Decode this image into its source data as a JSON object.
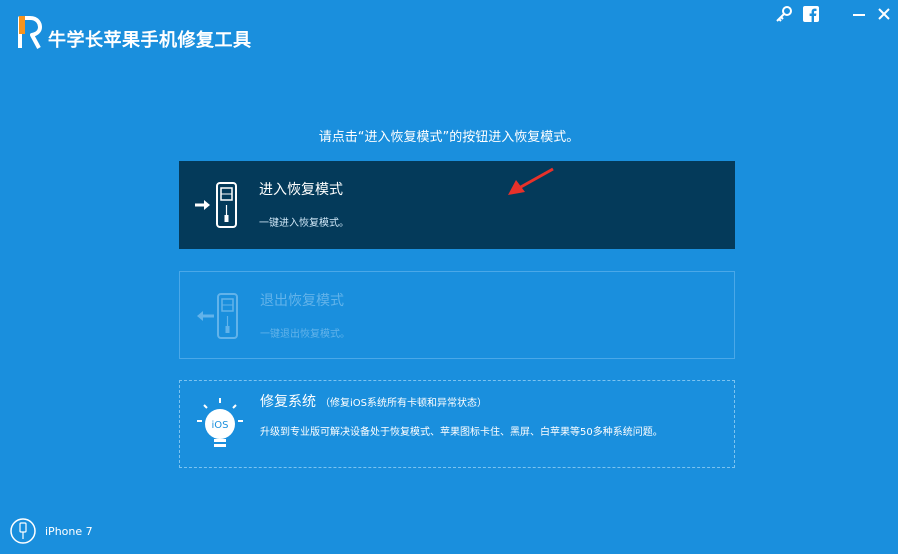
{
  "app": {
    "title": "牛学长苹果手机修复工具"
  },
  "window_controls": [
    {
      "name": "key-icon"
    },
    {
      "name": "facebook-icon"
    },
    {
      "name": "minimize-icon"
    },
    {
      "name": "close-icon"
    }
  ],
  "instruction": "请点击“进入恢复模式”的按钮进入恢复模式。",
  "options": {
    "enter": {
      "title": "进入恢复模式",
      "subtitle": "一键进入恢复模式。",
      "icon": "phone-enter-icon"
    },
    "exit": {
      "title": "退出恢复模式",
      "subtitle": "一键退出恢复模式。",
      "icon": "phone-exit-icon",
      "disabled": true
    },
    "repair": {
      "title": "修复系统",
      "title_note": "（修复iOS系统所有卡顿和异常状态）",
      "subtitle": "升级到专业版可解决设备处于恢复模式、苹果图标卡住、黑屏、白苹果等50多种系统问题。",
      "icon": "ios-bulb-icon",
      "icon_text": "iOS"
    }
  },
  "device": {
    "name": "iPhone 7",
    "icon": "iphone-cable-icon"
  },
  "colors": {
    "background": "#1a8fdd",
    "selected_card": "#043a5a",
    "disabled_text": "#62b3ea",
    "arrow": "#e8312a",
    "logo_accent": "#f7941d"
  }
}
